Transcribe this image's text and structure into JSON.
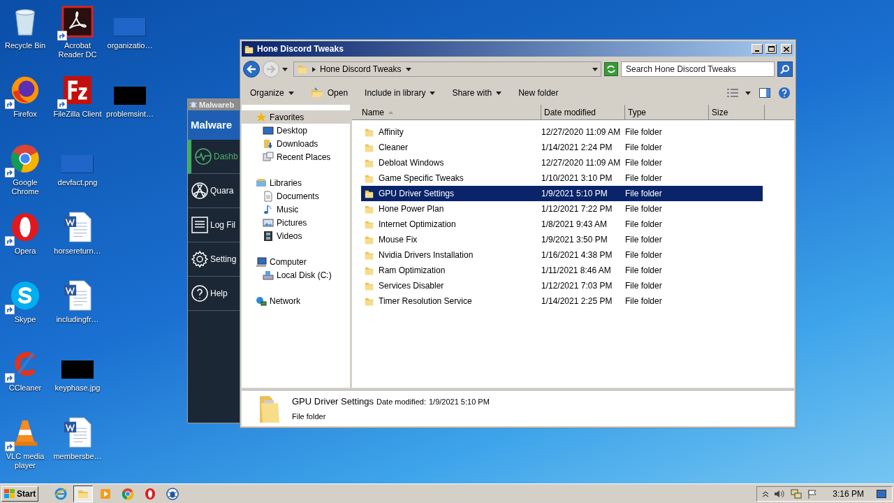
{
  "desktop": {
    "columns": [
      [
        {
          "label": "Recycle Bin",
          "kind": "recycle",
          "shortcut": false
        },
        {
          "label": "Firefox",
          "kind": "firefox",
          "shortcut": true
        },
        {
          "label": "Google Chrome",
          "kind": "chrome",
          "shortcut": true
        },
        {
          "label": "Opera",
          "kind": "opera",
          "shortcut": true
        },
        {
          "label": "Skype",
          "kind": "skype",
          "shortcut": true
        },
        {
          "label": "CCleaner",
          "kind": "ccleaner",
          "shortcut": true
        },
        {
          "label": "VLC media player",
          "kind": "vlc",
          "shortcut": true
        }
      ],
      [
        {
          "label": "Acrobat Reader DC",
          "kind": "acrobat",
          "shortcut": true
        },
        {
          "label": "FileZilla Client",
          "kind": "filezilla",
          "shortcut": true
        },
        {
          "label": "devfact.png",
          "kind": "thumb-light",
          "shortcut": false
        },
        {
          "label": "horsereturn…",
          "kind": "word",
          "shortcut": false
        },
        {
          "label": "includingfr…",
          "kind": "word",
          "shortcut": false
        },
        {
          "label": "keyphase.jpg",
          "kind": "thumb-dark",
          "shortcut": false
        },
        {
          "label": "membersbe…",
          "kind": "word",
          "shortcut": false
        }
      ],
      [
        {
          "label": "organizatio…",
          "kind": "thumb-light",
          "shortcut": false
        },
        {
          "label": "problemsint…",
          "kind": "thumb-dark",
          "shortcut": false
        }
      ]
    ]
  },
  "malwarebytes": {
    "title": "Malwareb",
    "logo": "Malware",
    "nav": [
      {
        "label": "Dashb",
        "kind": "pulse",
        "selected": true
      },
      {
        "label": "Quara",
        "kind": "radiation",
        "selected": false
      },
      {
        "label": "Log Fil",
        "kind": "log",
        "selected": false
      },
      {
        "label": "Setting",
        "kind": "gear",
        "selected": false
      },
      {
        "label": "Help",
        "kind": "help",
        "selected": false
      }
    ]
  },
  "explorer": {
    "title": "Hone Discord Tweaks",
    "address": "Hone Discord Tweaks",
    "search": {
      "placeholder": "Search Hone Discord Tweaks"
    },
    "toolbar": [
      {
        "label": "Organize",
        "dropdown": true,
        "kind": "plain"
      },
      {
        "label": "Open",
        "dropdown": false,
        "kind": "open"
      },
      {
        "label": "Include in library",
        "dropdown": true,
        "kind": "plain"
      },
      {
        "label": "Share with",
        "dropdown": true,
        "kind": "plain"
      },
      {
        "label": "New folder",
        "dropdown": false,
        "kind": "plain"
      }
    ],
    "nav_pane": [
      {
        "label": "Favorites",
        "kind": "star",
        "selected": true,
        "children": [
          {
            "label": "Desktop",
            "kind": "desktop"
          },
          {
            "label": "Downloads",
            "kind": "downloads"
          },
          {
            "label": "Recent Places",
            "kind": "recent"
          }
        ]
      },
      {
        "label": "Libraries",
        "kind": "libraries",
        "selected": false,
        "children": [
          {
            "label": "Documents",
            "kind": "documents"
          },
          {
            "label": "Music",
            "kind": "music"
          },
          {
            "label": "Pictures",
            "kind": "pictures"
          },
          {
            "label": "Videos",
            "kind": "videos"
          }
        ]
      },
      {
        "label": "Computer",
        "kind": "computer",
        "selected": false,
        "children": [
          {
            "label": "Local Disk (C:)",
            "kind": "disk"
          }
        ]
      },
      {
        "label": "Network",
        "kind": "network",
        "selected": false
      }
    ],
    "columns": [
      {
        "label": "Name",
        "sorted": true
      },
      {
        "label": "Date modified",
        "sorted": false
      },
      {
        "label": "Type",
        "sorted": false
      },
      {
        "label": "Size",
        "sorted": false
      }
    ],
    "rows": [
      {
        "name": "Affinity",
        "date": "12/27/2020 11:09 AM",
        "type": "File folder",
        "selected": false
      },
      {
        "name": "Cleaner",
        "date": "1/14/2021 2:24 PM",
        "type": "File folder",
        "selected": false
      },
      {
        "name": "Debloat Windows",
        "date": "12/27/2020 11:09 AM",
        "type": "File folder",
        "selected": false
      },
      {
        "name": "Game Specific Tweaks",
        "date": "1/10/2021 3:10 PM",
        "type": "File folder",
        "selected": false
      },
      {
        "name": "GPU Driver Settings",
        "date": "1/9/2021 5:10 PM",
        "type": "File folder",
        "selected": true
      },
      {
        "name": "Hone Power Plan",
        "date": "1/12/2021 7:22 PM",
        "type": "File folder",
        "selected": false
      },
      {
        "name": "Internet Optimization",
        "date": "1/8/2021 9:43 AM",
        "type": "File folder",
        "selected": false
      },
      {
        "name": "Mouse Fix",
        "date": "1/9/2021 3:50 PM",
        "type": "File folder",
        "selected": false
      },
      {
        "name": "Nvidia Drivers Installation",
        "date": "1/16/2021 4:38 PM",
        "type": "File folder",
        "selected": false
      },
      {
        "name": "Ram Optimization",
        "date": "1/11/2021 8:46 AM",
        "type": "File folder",
        "selected": false
      },
      {
        "name": "Services Disabler",
        "date": "1/12/2021 7:03 PM",
        "type": "File folder",
        "selected": false
      },
      {
        "name": "Timer Resolution Service",
        "date": "1/14/2021 2:25 PM",
        "type": "File folder",
        "selected": false
      }
    ],
    "details": {
      "name": "GPU Driver Settings",
      "date_label": "Date modified:",
      "date": "1/9/2021 5:10 PM",
      "type": "File folder"
    }
  },
  "taskbar": {
    "start": "Start",
    "apps": [
      {
        "kind": "ie",
        "active": false
      },
      {
        "kind": "explorer",
        "active": true
      },
      {
        "kind": "media",
        "active": false
      },
      {
        "kind": "chrome",
        "active": false
      },
      {
        "kind": "opera",
        "active": false
      },
      {
        "kind": "malwarebytes",
        "active": false
      }
    ],
    "clock": "3:16 PM"
  }
}
